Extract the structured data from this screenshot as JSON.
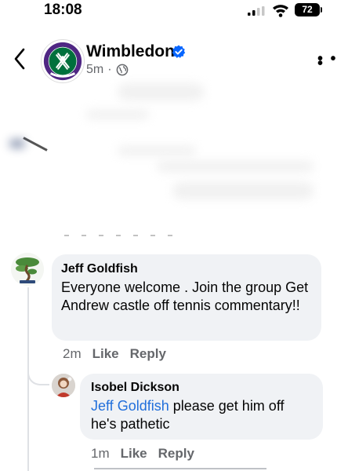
{
  "status_bar": {
    "time": "18:08",
    "battery": "72"
  },
  "header": {
    "page_name": "Wimbledon",
    "timestamp": "5m",
    "separator": "·"
  },
  "comments": [
    {
      "author": "Jeff Goldfish",
      "text": "Everyone welcome . Join the group Get Andrew castle  off tennis commentary!!",
      "time": "2m",
      "like": "Like",
      "reply": "Reply"
    },
    {
      "author": "Isobel Dickson",
      "mention": "Jeff Goldfish",
      "text": " please get him off he's pathetic",
      "time": "1m",
      "like": "Like",
      "reply": "Reply"
    }
  ],
  "colors": {
    "mention": "#216fdb",
    "verified": "#0866ff",
    "logo_green": "#00703c",
    "logo_purple": "#4f2683"
  },
  "icons": [
    "back-arrow-icon",
    "verified-badge-icon",
    "globe-icon",
    "more-options-icon",
    "signal-icon",
    "wifi-icon",
    "battery-icon"
  ]
}
